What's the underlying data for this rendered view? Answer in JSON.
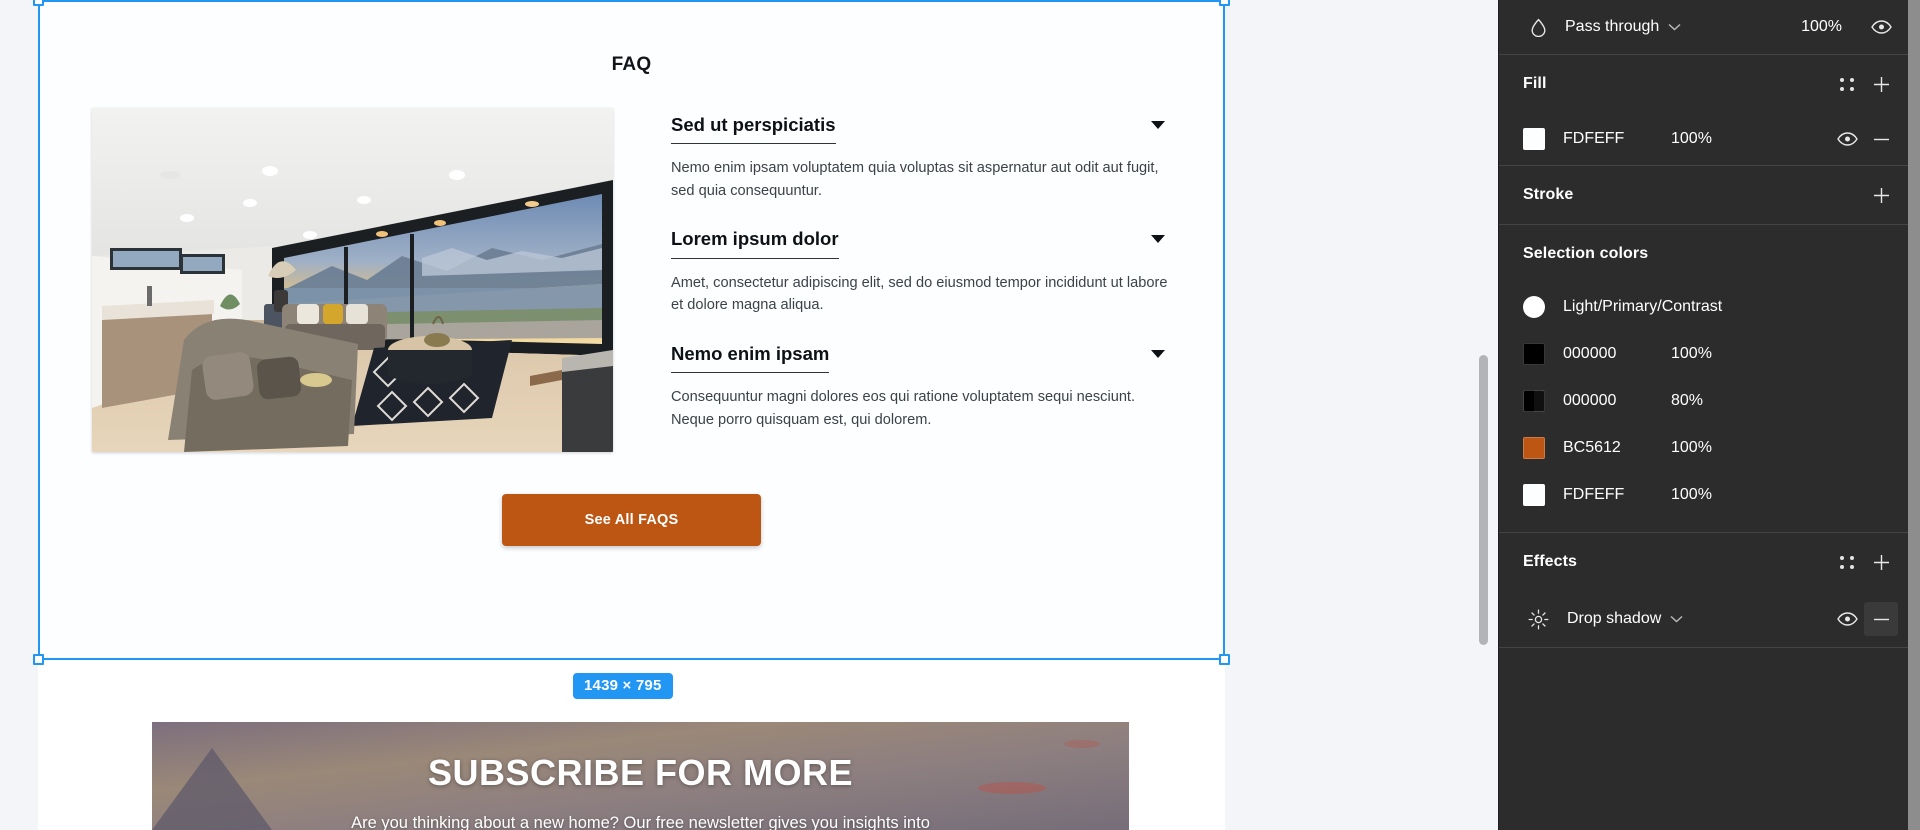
{
  "canvas": {
    "size_badge": "1439 × 795",
    "faq": {
      "title": "FAQ",
      "photo_alt": "modern-living-room-lake-view",
      "items": [
        {
          "question": "Sed ut perspiciatis",
          "answer": "Nemo enim ipsam voluptatem quia voluptas sit aspernatur aut odit aut fugit, sed quia consequuntur."
        },
        {
          "question": "Lorem ipsum dolor",
          "answer": "Amet, consectetur adipiscing elit, sed do eiusmod tempor incididunt ut labore et dolore magna aliqua."
        },
        {
          "question": "Nemo enim ipsam",
          "answer": "Consequuntur magni dolores eos qui ratione voluptatem sequi nesciunt. Neque porro quisquam est, qui dolorem."
        }
      ],
      "cta_label": "See All FAQS",
      "cta_color": "#BC5612"
    },
    "subscribe": {
      "heading": "SUBSCRIBE FOR MORE",
      "paragraph": "Are you thinking about a new home? Our free newsletter gives you insights into"
    },
    "selection_color": "#2196F3"
  },
  "panel": {
    "blend": {
      "icon": "blend-drop-icon",
      "mode": "Pass through",
      "opacity": "100%",
      "visibility_icon": "eye-icon"
    },
    "fill": {
      "title": "Fill",
      "styles_icon": "style-dots-icon",
      "add_icon": "plus-icon",
      "items": [
        {
          "color": "#FDFEFF",
          "hex": "FDFEFF",
          "opacity": "100%",
          "visibility_icon": "eye-icon",
          "remove_icon": "minus-icon"
        }
      ]
    },
    "stroke": {
      "title": "Stroke",
      "add_icon": "plus-icon"
    },
    "selection_colors": {
      "title": "Selection colors",
      "items": [
        {
          "color": "#FFFFFF",
          "shape": "circle",
          "label": "Light/Primary/Contrast",
          "opacity": ""
        },
        {
          "color": "#000000",
          "shape": "square",
          "label": "000000",
          "opacity": "100%"
        },
        {
          "color": "#000000",
          "shape": "checker",
          "label": "000000",
          "opacity": "80%"
        },
        {
          "color": "#BC5612",
          "shape": "square",
          "label": "BC5612",
          "opacity": "100%"
        },
        {
          "color": "#FDFEFF",
          "shape": "square",
          "label": "FDFEFF",
          "opacity": "100%"
        }
      ]
    },
    "effects": {
      "title": "Effects",
      "styles_icon": "style-dots-icon",
      "add_icon": "plus-icon",
      "items": [
        {
          "icon": "sun-effect-icon",
          "name": "Drop shadow",
          "chevron_icon": "chevron-down-icon",
          "visibility_icon": "eye-icon",
          "remove_icon": "minus-icon"
        }
      ]
    }
  }
}
